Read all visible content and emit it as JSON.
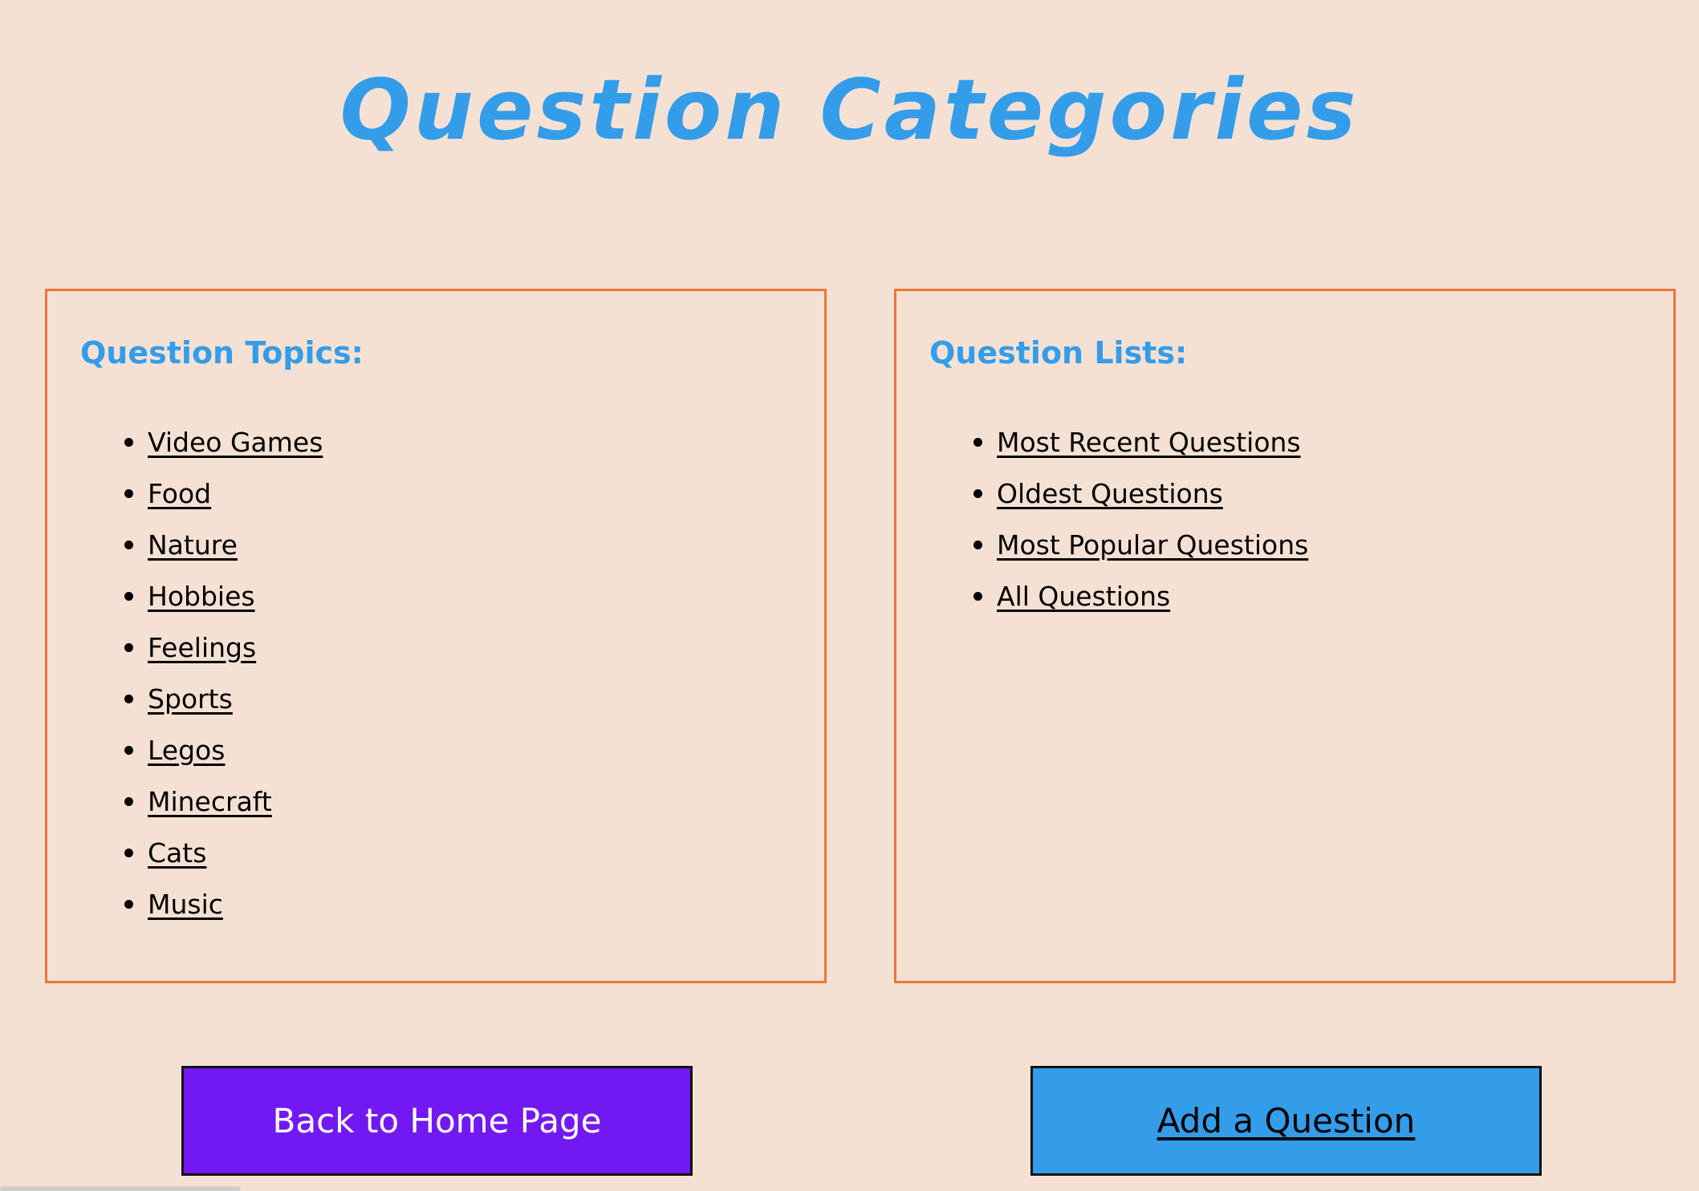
{
  "page": {
    "title": "Question Categories"
  },
  "topics_panel": {
    "heading": "Question Topics:",
    "items": [
      "Video Games",
      "Food",
      "Nature",
      "Hobbies",
      "Feelings",
      "Sports",
      "Legos",
      "Minecraft",
      "Cats",
      "Music"
    ]
  },
  "lists_panel": {
    "heading": "Question Lists:",
    "items": [
      "Most Recent Questions",
      "Oldest Questions",
      "Most Popular Questions",
      "All Questions"
    ]
  },
  "buttons": {
    "home_label": "Back to Home Page",
    "add_label": "Add a Question"
  },
  "colors": {
    "background": "#f5e1d4",
    "accent_blue": "#349de9",
    "border_orange": "#e9773a",
    "home_button": "#7219f3"
  }
}
